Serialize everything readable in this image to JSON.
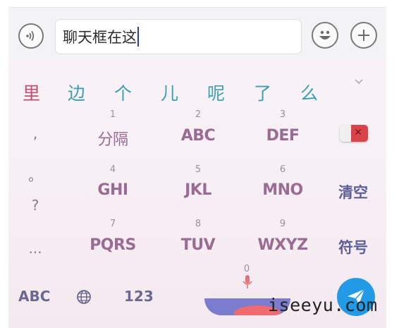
{
  "input": {
    "text": "聊天框在这"
  },
  "candidates": [
    "里",
    "边",
    "个",
    "儿",
    "呢",
    "了",
    "么"
  ],
  "keys": {
    "row1": [
      {
        "num": "1",
        "label": "分隔"
      },
      {
        "num": "2",
        "label": "ABC"
      },
      {
        "num": "3",
        "label": "DEF"
      }
    ],
    "row2": [
      {
        "num": "4",
        "label": "GHI"
      },
      {
        "num": "5",
        "label": "JKL"
      },
      {
        "num": "6",
        "label": "MNO"
      }
    ],
    "row3": [
      {
        "num": "7",
        "label": "PQRS"
      },
      {
        "num": "8",
        "label": "TUV"
      },
      {
        "num": "9",
        "label": "WXYZ"
      }
    ]
  },
  "punctuation": [
    ",",
    "。",
    "?",
    "..."
  ],
  "side": {
    "clear": "清空",
    "symbols": "符号"
  },
  "bottom": {
    "abc": "ABC",
    "numbers": "123",
    "zero": "0"
  },
  "watermark": "iseeyu.com",
  "colors": {
    "candidate_first": "#c44d70",
    "candidate_rest": "#3d9fb4",
    "key_text": "#9a6b93",
    "side_text": "#5d5f9a",
    "send": "#239ae6",
    "delete": "#d9444a"
  },
  "icons": [
    "voice-icon",
    "emoji-icon",
    "plus-icon",
    "chevron-down-icon",
    "delete-icon",
    "globe-icon",
    "microphone-icon",
    "send-icon"
  ]
}
